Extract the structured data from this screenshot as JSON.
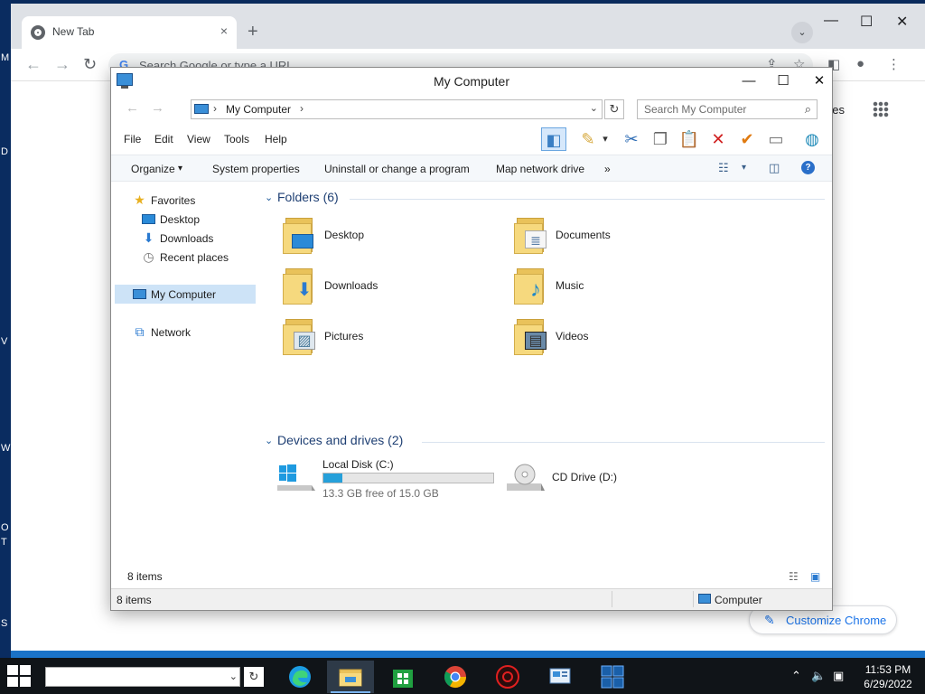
{
  "browser": {
    "tab_title": "New Tab",
    "tab_close": "×",
    "new_tab": "+",
    "tab_search": "⌄",
    "window_controls": {
      "minimize": "—",
      "maximize": "☐",
      "close": "✕"
    },
    "back": "←",
    "forward": "→",
    "reload": "↻",
    "omnibox_g": "G",
    "omnibox_placeholder": "Search Google or type a URL",
    "share": "⇪",
    "bookmark": "☆",
    "sidepanel": "◧",
    "profile": "●",
    "menu": "⋮",
    "images_link": "ges",
    "customize_icon": "✎",
    "customize_label": "Customize Chrome"
  },
  "desktop_edge": [
    "M",
    "D",
    "V",
    "W",
    "O",
    "T",
    "S"
  ],
  "explorer": {
    "title": "My Computer",
    "controls": {
      "minimize": "—",
      "maximize": "☐",
      "close": "✕"
    },
    "nav_back": "←",
    "nav_forward": "→",
    "address_sep": "›",
    "address": "My Computer",
    "address_dropdown": "⌄",
    "refresh": "↻",
    "search_placeholder": "Search My Computer",
    "search_icon": "⌕",
    "menu": [
      "File",
      "Edit",
      "View",
      "Tools",
      "Help"
    ],
    "toolbar_icons": {
      "preview_pane": "◧",
      "move": "✎",
      "dropdown": "▾",
      "cut": "✂",
      "copy": "❐",
      "paste": "📋",
      "delete": "✕",
      "confirm": "✔",
      "properties": "▭",
      "shell": "◍"
    },
    "commands": {
      "organize": "Organize",
      "organize_arrow": "▾",
      "system_properties": "System properties",
      "uninstall": "Uninstall or change a program",
      "map_drive": "Map network drive",
      "more": "»",
      "view_icon": "☷",
      "view_dd": "▾",
      "pane_icon": "◫",
      "help_icon": "?"
    },
    "nav": {
      "favorites": "Favorites",
      "desktop": "Desktop",
      "downloads": "Downloads",
      "recent": "Recent places",
      "my_computer": "My Computer",
      "network": "Network"
    },
    "nav_icons": {
      "star": "★",
      "downloads": "⬇",
      "recent": "◷",
      "network": "⧉"
    },
    "group_chevron": "⌄",
    "folders_header": "Folders (6)",
    "folders": {
      "desktop": "Desktop",
      "documents": "Documents",
      "downloads": "Downloads",
      "music": "Music",
      "pictures": "Pictures",
      "videos": "Videos"
    },
    "folder_icons": {
      "downloads": "⬇",
      "documents": "≣",
      "music": "♪",
      "pictures": "▨",
      "videos": "▤"
    },
    "devices_header": "Devices and drives (2)",
    "drives": {
      "local": {
        "name": "Local Disk (C:)",
        "free": "13.3 GB free of 15.0 GB",
        "used_fraction": 0.113
      },
      "cd": {
        "name": "CD Drive (D:)"
      }
    },
    "details_count": "8 items",
    "view_icons": {
      "details": "☷",
      "tiles": "▣"
    },
    "status_count": "8 items",
    "status_zone": "Computer"
  },
  "taskbar": {
    "search_dropdown": "⌄",
    "search_button": "↻",
    "tray": {
      "chevron": "⌃",
      "volume": "🔈",
      "network": "▣"
    },
    "time": "11:53 PM",
    "date": "6/29/2022"
  }
}
